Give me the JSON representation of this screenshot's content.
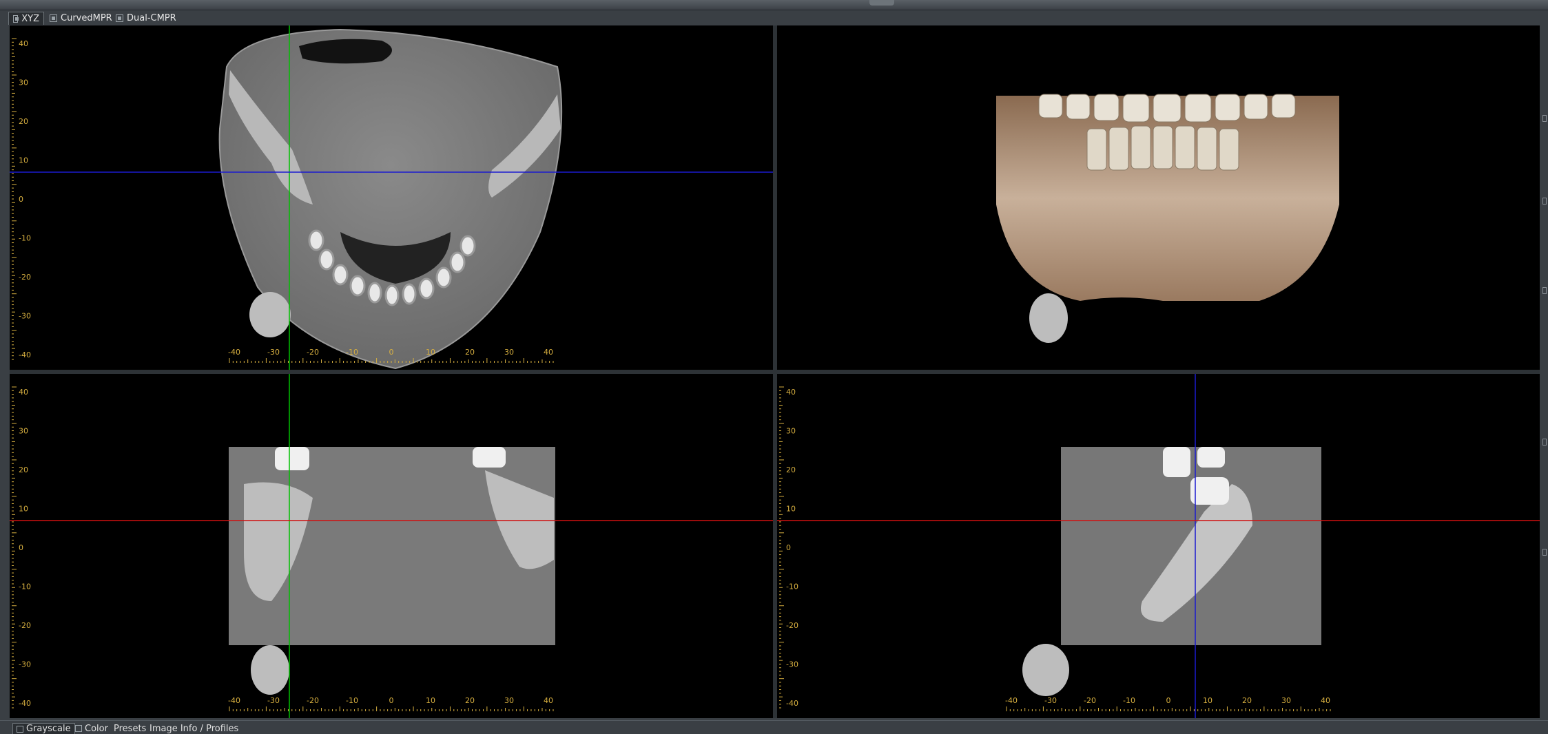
{
  "tabs": [
    {
      "label": "XYZ",
      "active": true
    },
    {
      "label": "CurvedMPR",
      "active": false
    },
    {
      "label": "Dual-CMPR",
      "active": false
    }
  ],
  "views": {
    "axial": {
      "name": "Axial view",
      "crosshair": {
        "vertical_mm": -26,
        "horizontal_mm": 7
      }
    },
    "volume3d": {
      "name": "3D volume rendering"
    },
    "coronal": {
      "name": "Coronal view",
      "crosshair": {
        "vertical_mm": -26,
        "horizontal_mm": 8
      }
    },
    "sagittal": {
      "name": "Sagittal view",
      "crosshair": {
        "vertical_mm": 7,
        "horizontal_mm": 8
      }
    }
  },
  "ruler": {
    "vertical_labels": [
      "40",
      "30",
      "20",
      "10",
      "0",
      "-10",
      "-20",
      "-30",
      "-40"
    ],
    "horizontal_labels": [
      "-40",
      "-30",
      "-20",
      "-10",
      "0",
      "10",
      "20",
      "30",
      "40"
    ],
    "range_mm": [
      -44,
      44
    ]
  },
  "colors": {
    "green_line": "#00c000",
    "blue_line": "#1a1ad0",
    "red_line": "#d01010",
    "ruler": "#d8b040"
  },
  "bottom_tabs": [
    {
      "label": "Grayscale",
      "active": true
    },
    {
      "label": "Color",
      "active": false
    },
    {
      "label": "Presets",
      "active": false
    },
    {
      "label": "Image Info / Profiles",
      "active": false
    }
  ]
}
